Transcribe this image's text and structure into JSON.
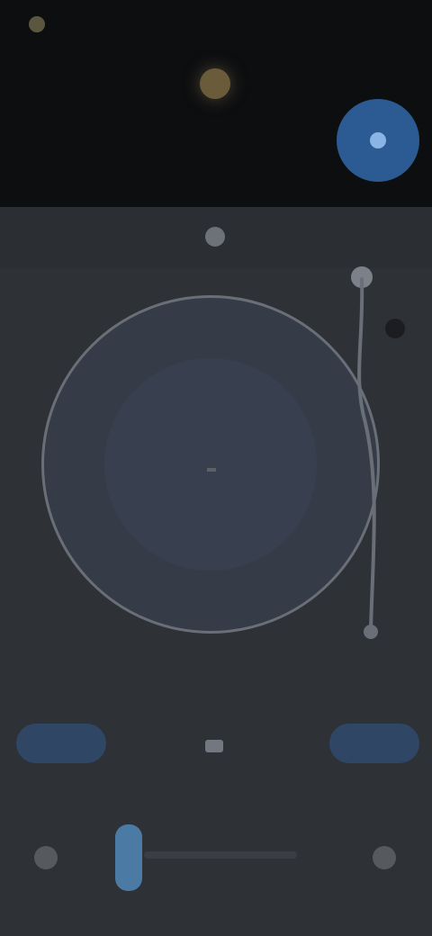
{
  "status": {
    "left_label": "",
    "right_label": ""
  },
  "header": {
    "queue_label": ""
  },
  "subbar": {
    "left_label": ""
  },
  "turntable": {
    "bpm_text": ""
  },
  "controls": {
    "top_left_label": "",
    "top_center_label": "",
    "top_right_label": "",
    "left_button_label": "",
    "right_button_label": "",
    "row": [
      "",
      "",
      "",
      "",
      ""
    ]
  },
  "colors": {
    "accent": "#2c5b93",
    "platter": "#353c47",
    "background": "#2e3136"
  },
  "icons": [
    "status-icon",
    "track-art-icon",
    "play-icon",
    "tonearm-icon",
    "left-nav-icon",
    "right-nav-icon"
  ]
}
